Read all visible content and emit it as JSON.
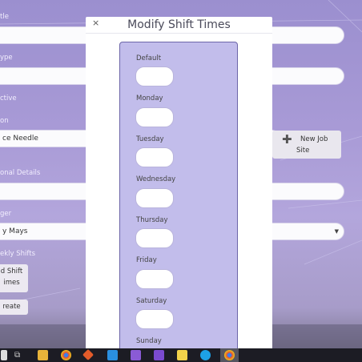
{
  "modal": {
    "title": "Modify Shift Times",
    "close": "×",
    "days": [
      {
        "label": "Default",
        "value": ""
      },
      {
        "label": "Monday",
        "value": ""
      },
      {
        "label": "Tuesday",
        "value": ""
      },
      {
        "label": "Wednesday",
        "value": ""
      },
      {
        "label": "Thursday",
        "value": ""
      },
      {
        "label": "Friday",
        "value": ""
      },
      {
        "label": "Saturday",
        "value": ""
      },
      {
        "label": "Sunday",
        "value": ""
      }
    ]
  },
  "form": {
    "title_label": "tle",
    "type_label": "ype",
    "active_label": "ctive",
    "location_label": "on",
    "location_value": "ce Needle",
    "additional_label": "onal Details",
    "manager_label": "ger",
    "manager_value": "y Mays",
    "weekly_label": "ekly Shifts",
    "add_shift_line1": "d Shift",
    "add_shift_line2": "imes",
    "create_button": "reate",
    "new_job_line1": "New Job",
    "new_job_line2": "Site"
  },
  "taskbar": {
    "icons": [
      "task-view-icon",
      "file-explorer-icon",
      "chrome-icon",
      "git-icon",
      "vscode-icon",
      "visual-studio-icon",
      "visual-studio-2-icon",
      "sticky-notes-icon",
      "skype-icon",
      "chrome-active-icon"
    ]
  }
}
